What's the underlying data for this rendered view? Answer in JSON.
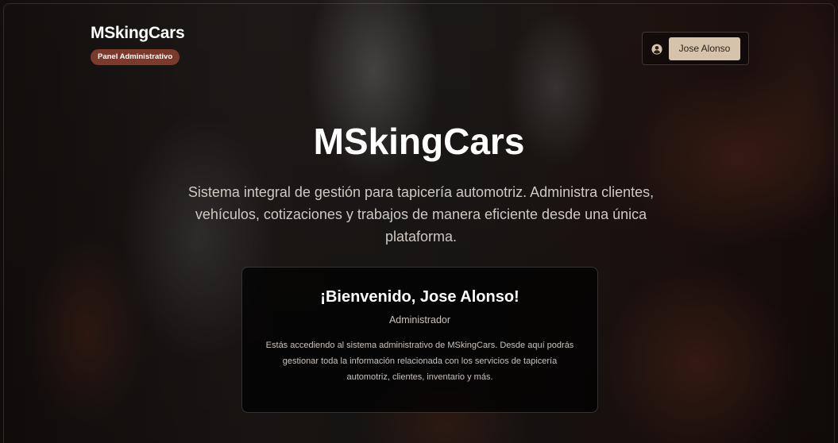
{
  "header": {
    "brand_title": "MSkingCars",
    "brand_badge": "Panel Administrativo",
    "user_name": "Jose Alonso",
    "user_icon": "user-circle-icon"
  },
  "hero": {
    "title": "MSkingCars",
    "description": "Sistema integral de gestión para tapicería automotriz. Administra clientes, vehículos, cotizaciones y trabajos de manera eficiente desde una única plataforma."
  },
  "welcome_card": {
    "title": "¡Bienvenido, Jose Alonso!",
    "role": "Administrador",
    "text": "Estás accediendo al sistema administrativo de MSkingCars. Desde aquí podrás gestionar toda la información relacionada con los servicios de tapicería automotriz, clientes, inventario y más."
  },
  "colors": {
    "badge": "#7a3a2c",
    "user_button": "#d6c3ab"
  }
}
